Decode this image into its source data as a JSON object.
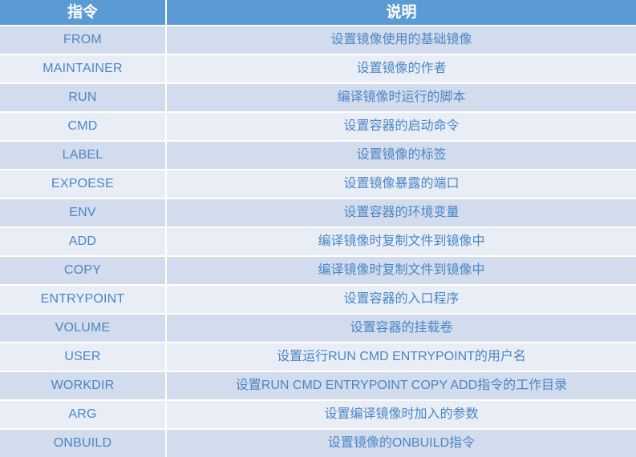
{
  "table": {
    "headers": {
      "command": "指令",
      "description": "说明"
    },
    "rows": [
      {
        "command": "FROM",
        "description": "设置镜像使用的基础镜像"
      },
      {
        "command": "MAINTAINER",
        "description": "设置镜像的作者"
      },
      {
        "command": "RUN",
        "description": "编译镜像时运行的脚本"
      },
      {
        "command": "CMD",
        "description": "设置容器的启动命令"
      },
      {
        "command": "LABEL",
        "description": "设置镜像的标签"
      },
      {
        "command": "EXPOESE",
        "description": "设置镜像暴露的端口"
      },
      {
        "command": "ENV",
        "description": "设置容器的环境变量"
      },
      {
        "command": "ADD",
        "description": "编译镜像时复制文件到镜像中"
      },
      {
        "command": "COPY",
        "description": "编译镜像时复制文件到镜像中"
      },
      {
        "command": "ENTRYPOINT",
        "description": "设置容器的入口程序"
      },
      {
        "command": "VOLUME",
        "description": "设置容器的挂载卷"
      },
      {
        "command": "USER",
        "description": "设置运行RUN CMD ENTRYPOINT的用户名"
      },
      {
        "command": "WORKDIR",
        "description": "设置RUN CMD ENTRYPOINT COPY ADD指令的工作目录"
      },
      {
        "command": "ARG",
        "description": "设置编译镜像时加入的参数"
      },
      {
        "command": "ONBUILD",
        "description": "设置镜像的ONBUILD指令"
      }
    ]
  },
  "colors": {
    "header_background": "#5b9bd5",
    "header_text": "#ffffff",
    "row_odd_background": "#d3dcec",
    "row_even_background": "#e9edf6",
    "cell_text": "#4a86c8",
    "separator": "#ffffff"
  }
}
